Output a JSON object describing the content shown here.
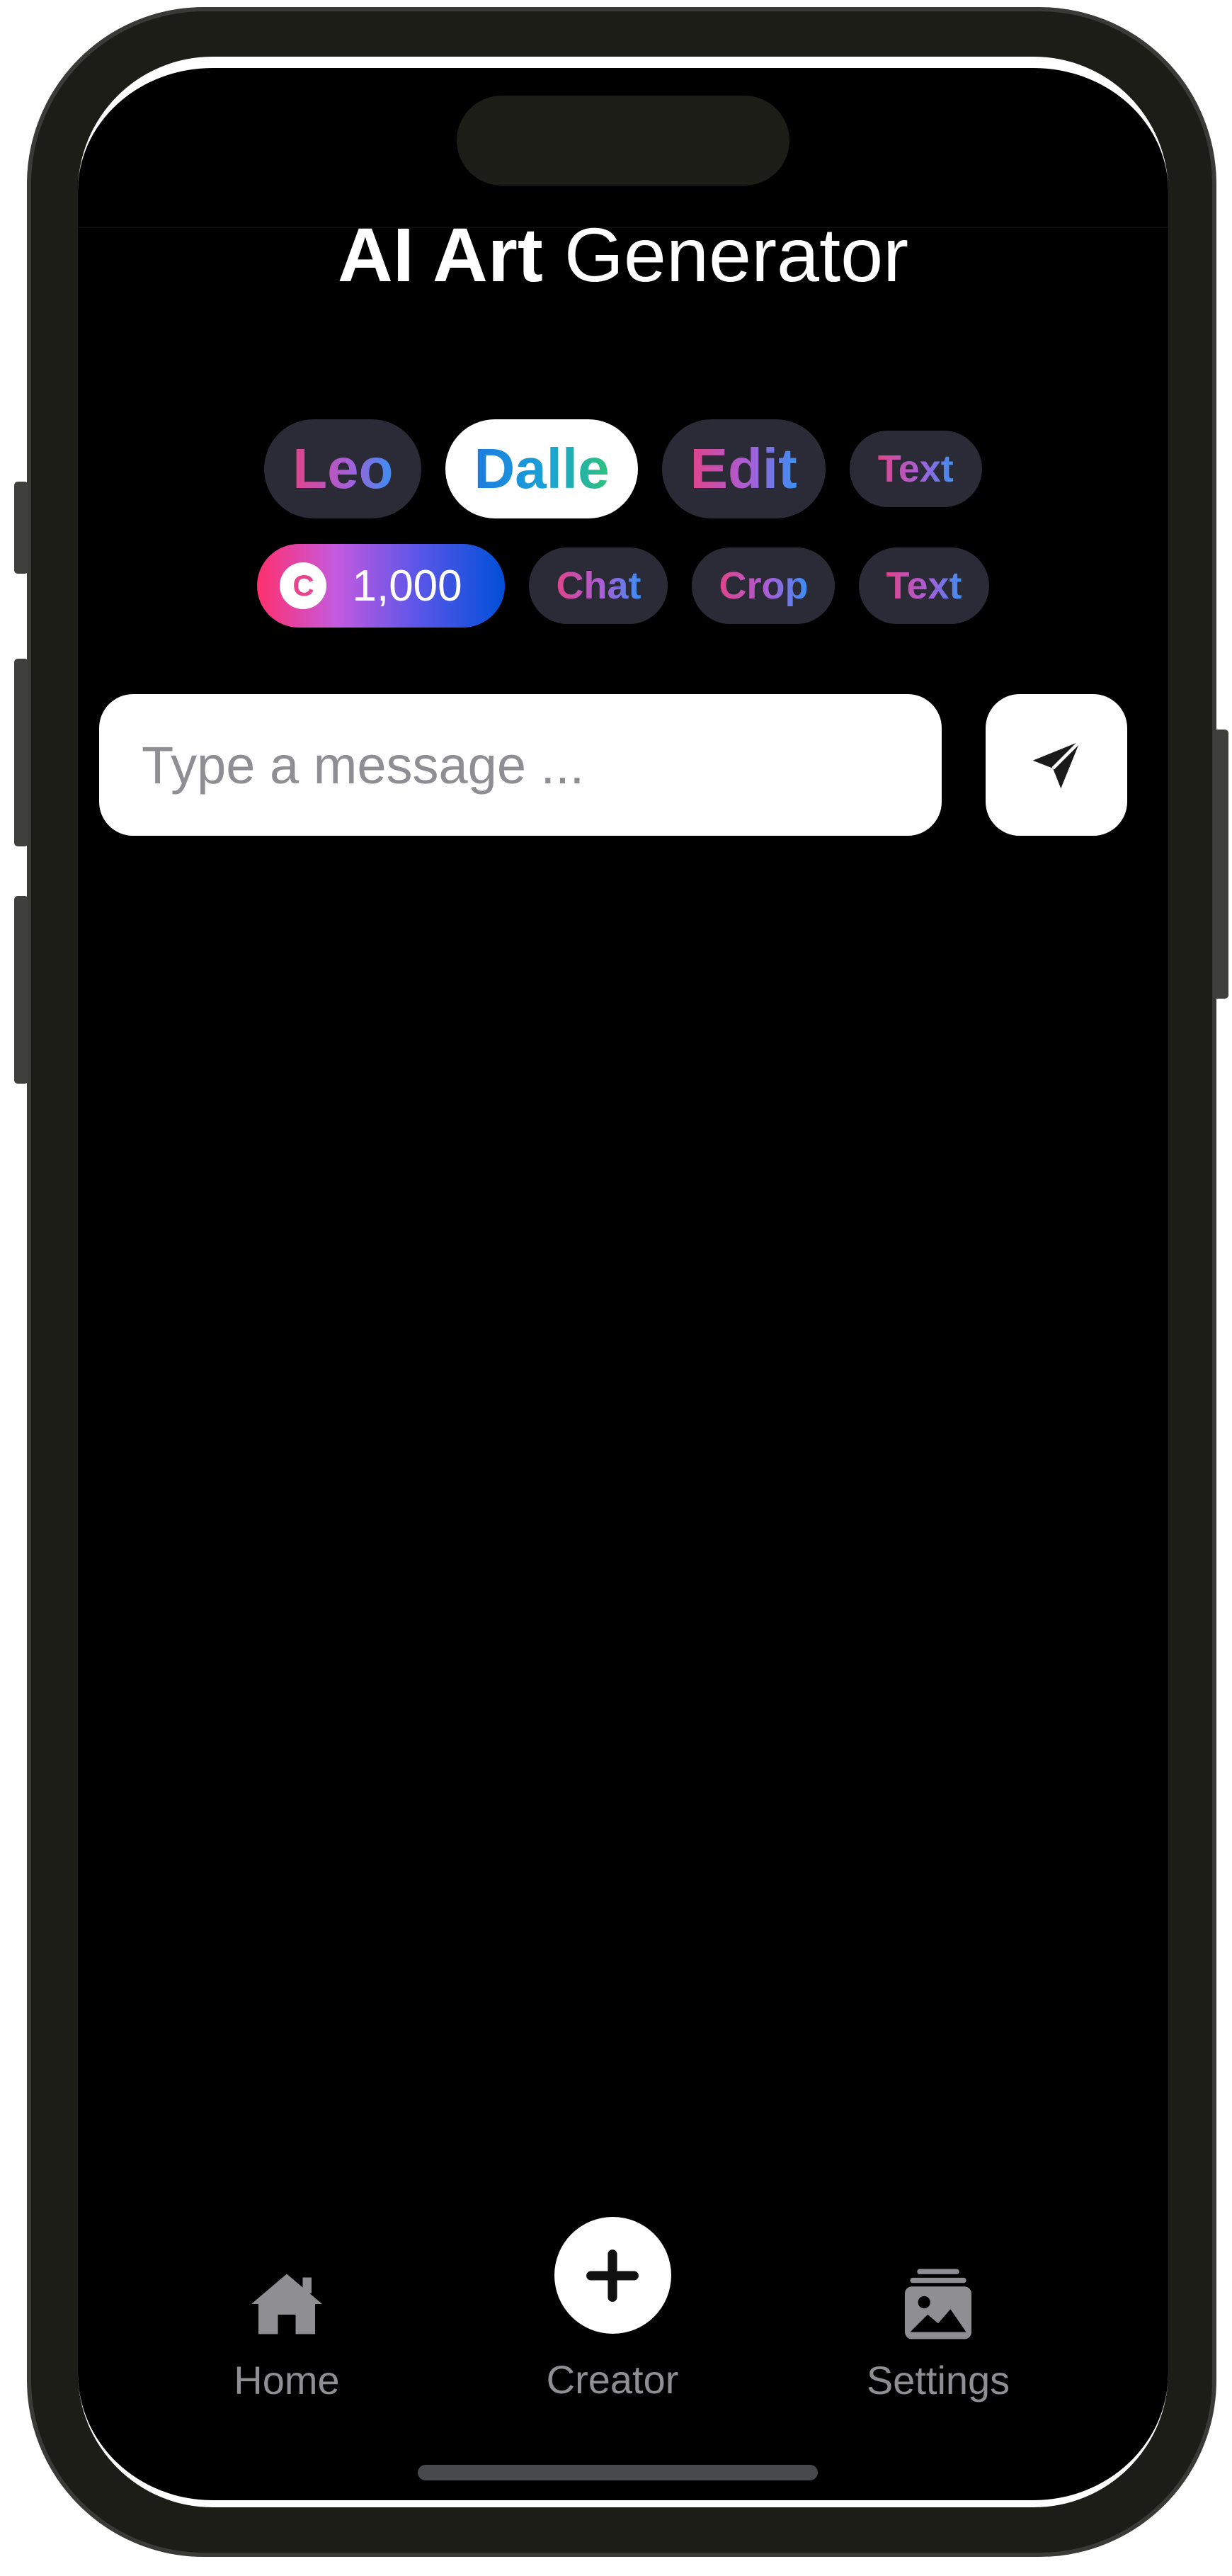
{
  "app": {
    "title_bold": "AI Art",
    "title_light": "Generator"
  },
  "model_chips": [
    {
      "label": "Leo",
      "selected": false
    },
    {
      "label": "Dalle",
      "selected": true
    },
    {
      "label": "Edit",
      "selected": false
    },
    {
      "label": "Text",
      "selected": false
    }
  ],
  "credits": {
    "icon_letter": "C",
    "amount": "1,000"
  },
  "tool_chips": [
    {
      "label": "Chat"
    },
    {
      "label": "Crop"
    },
    {
      "label": "Text"
    }
  ],
  "composer": {
    "placeholder": "Type a message ...",
    "value": "",
    "send_icon": "paper-plane-icon"
  },
  "tabbar": {
    "home": {
      "label": "Home",
      "icon": "house-icon"
    },
    "creator": {
      "label": "Creator",
      "icon": "plus-icon"
    },
    "settings": {
      "label": "Settings",
      "icon": "photo-stack-icon"
    }
  },
  "colors": {
    "background": "#000000",
    "chip_bg": "#2a2b36",
    "chip_active_bg": "#ffffff",
    "tab_inactive": "#8e8e93",
    "credit_gradient_start": "#ff2f6d",
    "credit_gradient_end": "#0050d8"
  }
}
